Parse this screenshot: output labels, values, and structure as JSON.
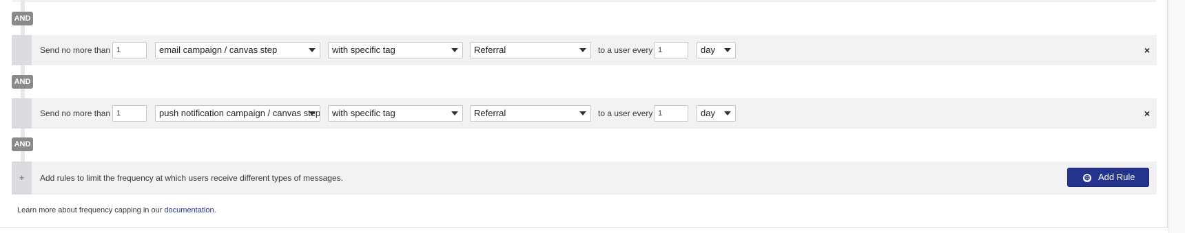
{
  "and_label": "AND",
  "rules": [
    {
      "prefix": "Send no more than",
      "count": "1",
      "message_type": "email campaign / canvas step",
      "filter": "with specific tag",
      "tag": "Referral",
      "middle": "to a user every",
      "interval": "1",
      "unit": "day",
      "remove": "×"
    },
    {
      "prefix": "Send no more than",
      "count": "1",
      "message_type": "push notification campaign / canvas step",
      "filter": "with specific tag",
      "tag": "Referral",
      "middle": "to a user every",
      "interval": "1",
      "unit": "day",
      "remove": "×"
    }
  ],
  "add_rule": {
    "plus": "+",
    "description": "Add rules to limit the frequency at which users receive different types of messages.",
    "button_label": "Add Rule",
    "button_icon": "⊕"
  },
  "footer": {
    "before": "Learn more about frequency capping in our ",
    "link": "documentation",
    "after": "."
  },
  "colors": {
    "accent": "#24338c",
    "badge": "#8a8a8a",
    "row_bg": "#f2f2f4"
  }
}
